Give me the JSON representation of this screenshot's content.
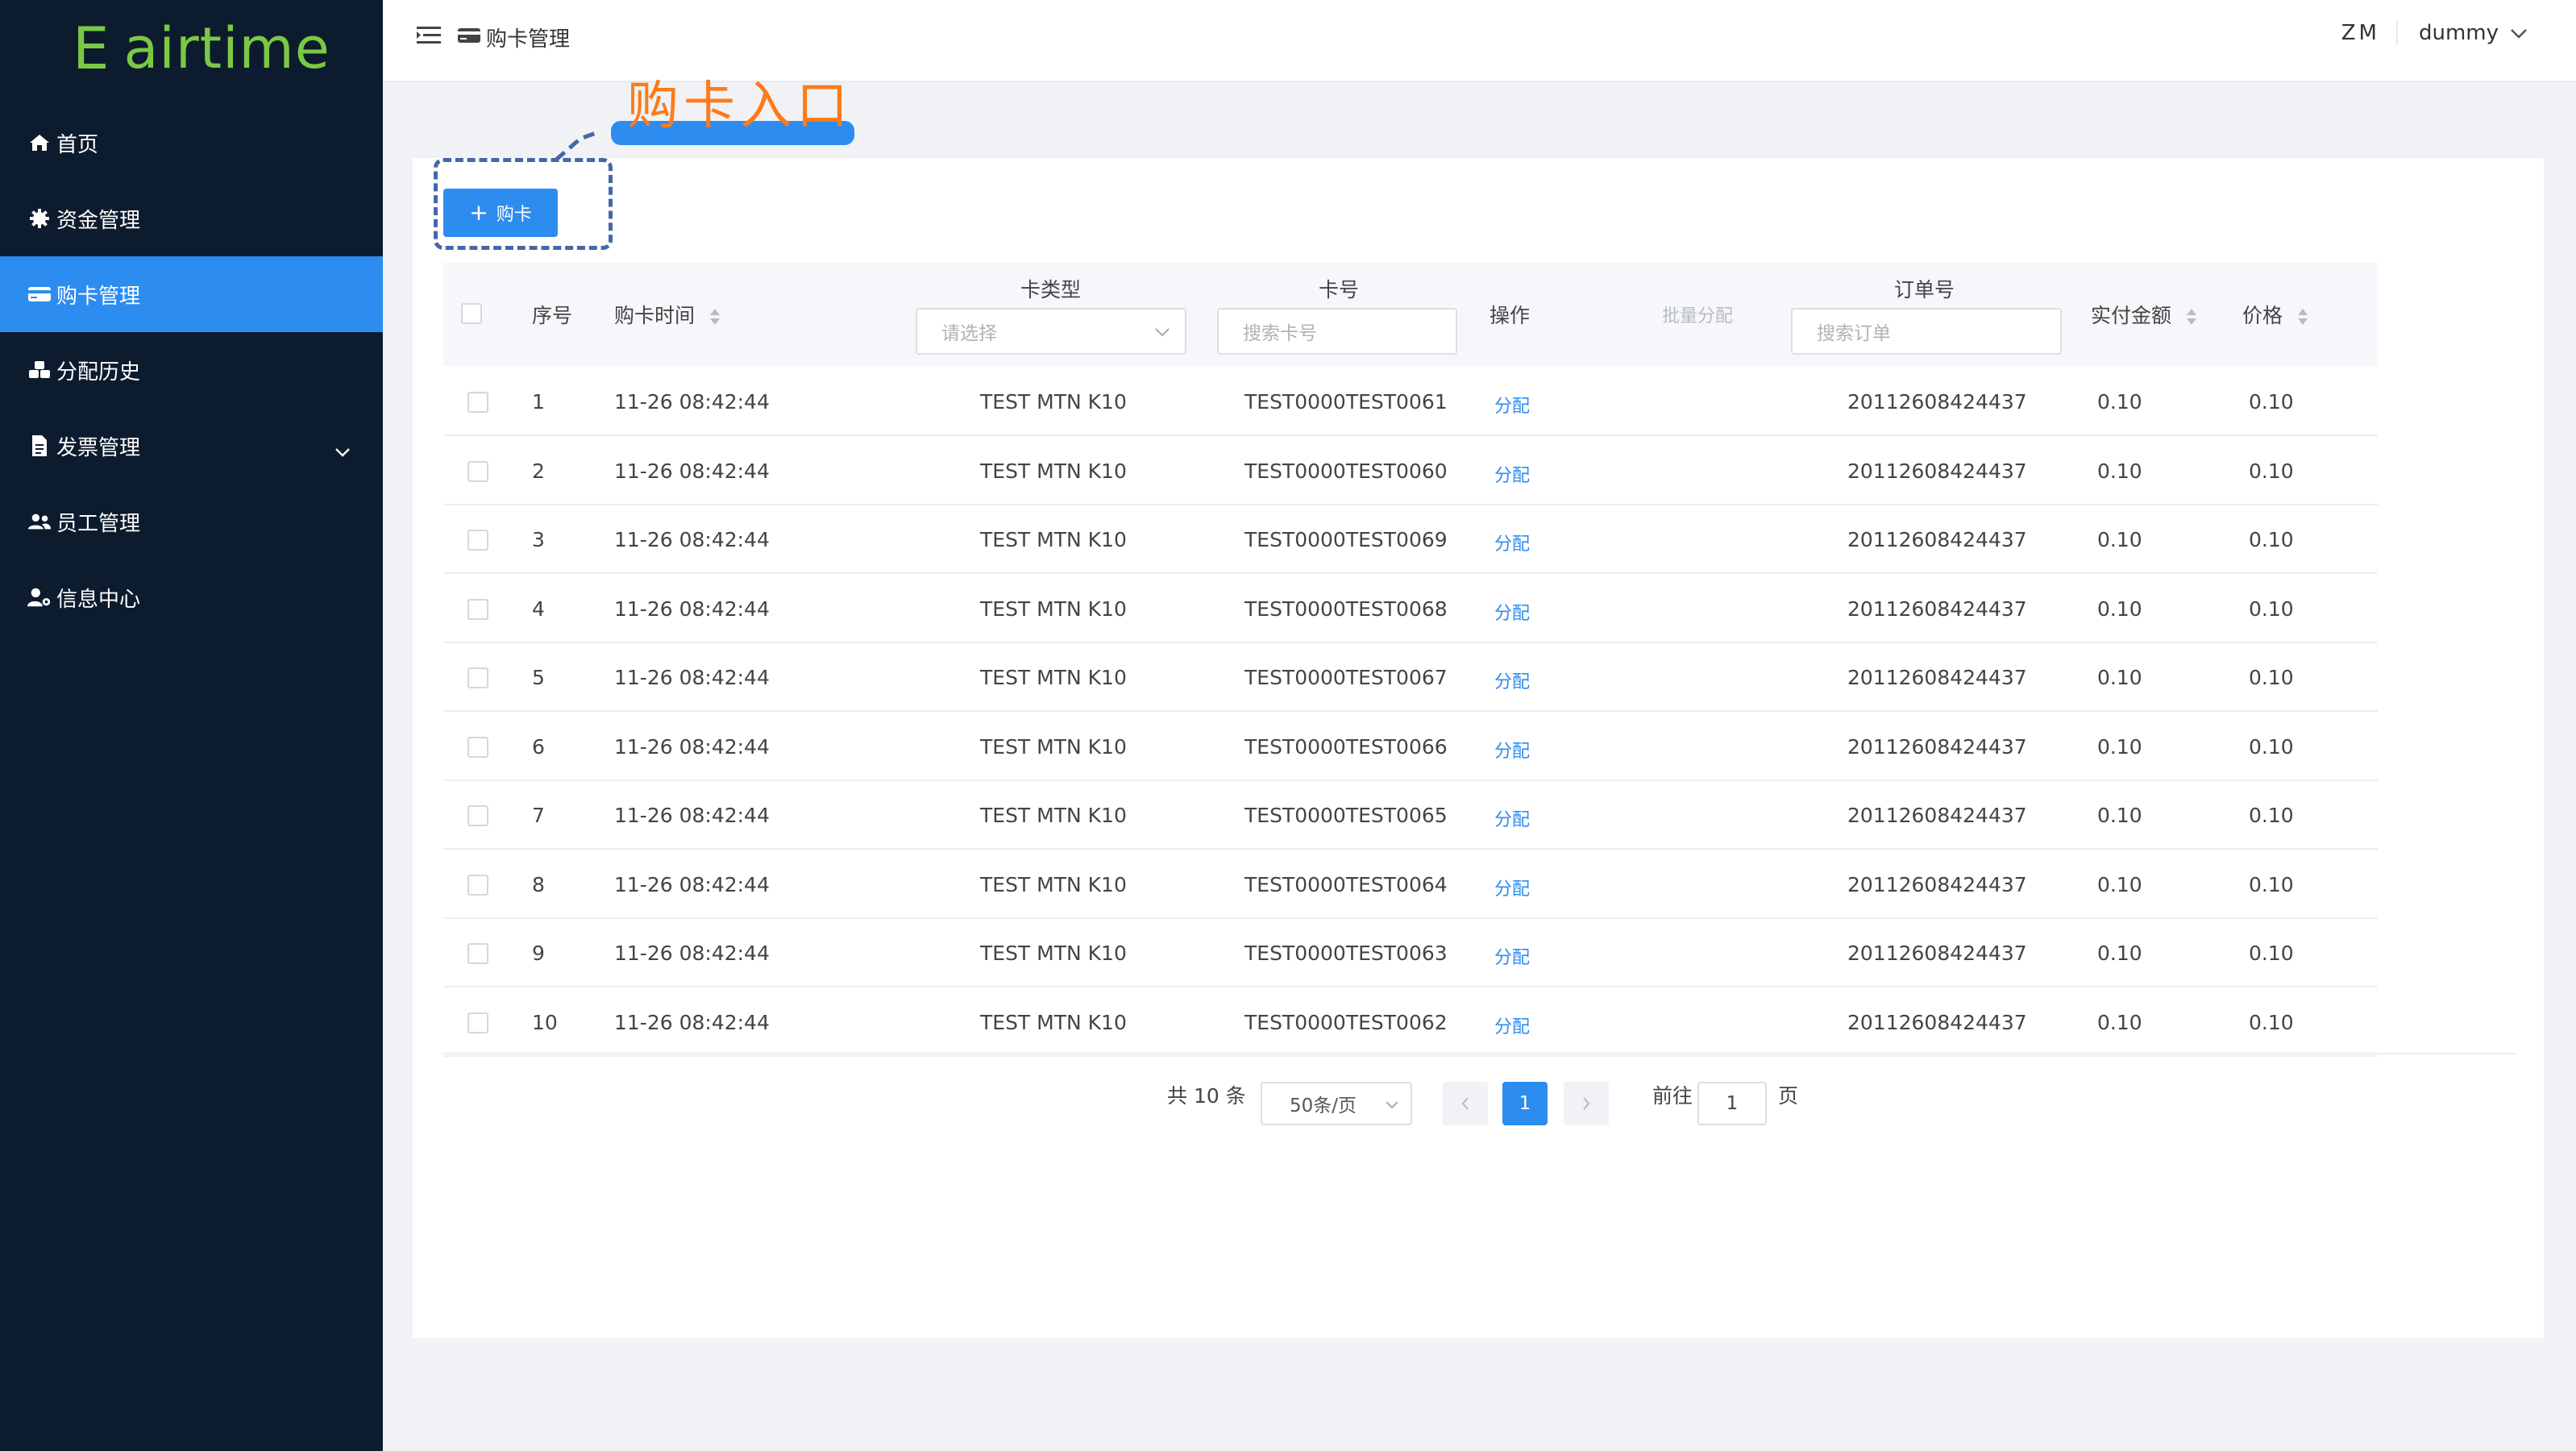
{
  "app": {
    "logo_mark": "E",
    "logo_text": "airtime"
  },
  "sidebar": {
    "items": [
      {
        "label": "首页",
        "icon": "home-icon"
      },
      {
        "label": "资金管理",
        "icon": "gear-icon"
      },
      {
        "label": "购卡管理",
        "icon": "card-icon",
        "active": true
      },
      {
        "label": "分配历史",
        "icon": "cubes-icon"
      },
      {
        "label": "发票管理",
        "icon": "document-icon",
        "expandable": true
      },
      {
        "label": "员工管理",
        "icon": "users-icon"
      },
      {
        "label": "信息中心",
        "icon": "user-gear-icon"
      }
    ]
  },
  "header": {
    "breadcrumb": "购卡管理",
    "initials": "ZM",
    "username": "dummy"
  },
  "annotation": {
    "label": "购卡入口"
  },
  "toolbar": {
    "buy_label": "购卡"
  },
  "table": {
    "headers": {
      "index": "序号",
      "buy_time": "购卡时间",
      "card_type": "卡类型",
      "card_no": "卡号",
      "action": "操作",
      "batch": "批量分配",
      "order_no": "订单号",
      "paid": "实付金额",
      "price": "价格"
    },
    "filters": {
      "card_type_placeholder": "请选择",
      "card_no_placeholder": "搜索卡号",
      "order_no_placeholder": "搜索订单"
    },
    "rows": [
      {
        "index": "1",
        "time": "11-26 08:42:44",
        "type": "TEST MTN K10",
        "card": "TEST0000TEST0061",
        "op": "分配",
        "order": "20112608424437",
        "paid": "0.10",
        "price": "0.10"
      },
      {
        "index": "2",
        "time": "11-26 08:42:44",
        "type": "TEST MTN K10",
        "card": "TEST0000TEST0060",
        "op": "分配",
        "order": "20112608424437",
        "paid": "0.10",
        "price": "0.10"
      },
      {
        "index": "3",
        "time": "11-26 08:42:44",
        "type": "TEST MTN K10",
        "card": "TEST0000TEST0069",
        "op": "分配",
        "order": "20112608424437",
        "paid": "0.10",
        "price": "0.10"
      },
      {
        "index": "4",
        "time": "11-26 08:42:44",
        "type": "TEST MTN K10",
        "card": "TEST0000TEST0068",
        "op": "分配",
        "order": "20112608424437",
        "paid": "0.10",
        "price": "0.10"
      },
      {
        "index": "5",
        "time": "11-26 08:42:44",
        "type": "TEST MTN K10",
        "card": "TEST0000TEST0067",
        "op": "分配",
        "order": "20112608424437",
        "paid": "0.10",
        "price": "0.10"
      },
      {
        "index": "6",
        "time": "11-26 08:42:44",
        "type": "TEST MTN K10",
        "card": "TEST0000TEST0066",
        "op": "分配",
        "order": "20112608424437",
        "paid": "0.10",
        "price": "0.10"
      },
      {
        "index": "7",
        "time": "11-26 08:42:44",
        "type": "TEST MTN K10",
        "card": "TEST0000TEST0065",
        "op": "分配",
        "order": "20112608424437",
        "paid": "0.10",
        "price": "0.10"
      },
      {
        "index": "8",
        "time": "11-26 08:42:44",
        "type": "TEST MTN K10",
        "card": "TEST0000TEST0064",
        "op": "分配",
        "order": "20112608424437",
        "paid": "0.10",
        "price": "0.10"
      },
      {
        "index": "9",
        "time": "11-26 08:42:44",
        "type": "TEST MTN K10",
        "card": "TEST0000TEST0063",
        "op": "分配",
        "order": "20112608424437",
        "paid": "0.10",
        "price": "0.10"
      },
      {
        "index": "10",
        "time": "11-26 08:42:44",
        "type": "TEST MTN K10",
        "card": "TEST0000TEST0062",
        "op": "分配",
        "order": "20112608424437",
        "paid": "0.10",
        "price": "0.10"
      }
    ]
  },
  "pagination": {
    "total": "共 10 条",
    "page_size": "50条/页",
    "current": "1",
    "goto_label": "前往",
    "goto_value": "1",
    "page_suffix": "页"
  },
  "colors": {
    "sidebar_bg": "#0d1b2e",
    "accent": "#2d8cf0",
    "logo": "#7ac943",
    "annotation": "#ff7a1a"
  }
}
